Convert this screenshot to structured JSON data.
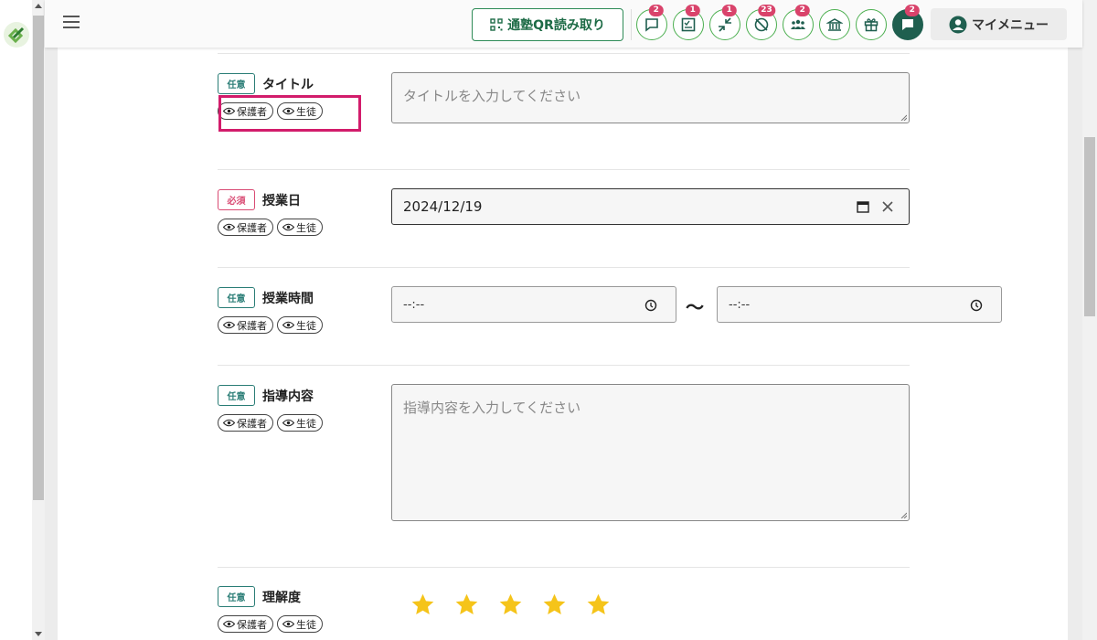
{
  "header": {
    "qr_button_label": "通塾QR読み取り",
    "icons": [
      {
        "name": "message-icon",
        "badge": "2"
      },
      {
        "name": "checklist-icon",
        "badge": "1"
      },
      {
        "name": "transfer-icon",
        "badge": "1"
      },
      {
        "name": "no-entry-icon",
        "badge": "23"
      },
      {
        "name": "group-icon",
        "badge": "2"
      },
      {
        "name": "school-icon",
        "badge": ""
      },
      {
        "name": "gift-icon",
        "badge": ""
      },
      {
        "name": "chat-icon",
        "badge": "2"
      }
    ],
    "my_menu_label": "マイメニュー"
  },
  "visibility_labels": {
    "guardian": "保護者",
    "student": "生徒"
  },
  "fields": {
    "title": {
      "badge": "任意",
      "label": "タイトル",
      "placeholder": "タイトルを入力してください"
    },
    "lesson_date": {
      "badge": "必須",
      "label": "授業日",
      "value": "2024/12/19"
    },
    "lesson_time": {
      "badge": "任意",
      "label": "授業時間",
      "start": "--:--",
      "separator": "〜",
      "end": "--:--"
    },
    "guidance": {
      "badge": "任意",
      "label": "指導内容",
      "placeholder": "指導内容を入力してください"
    },
    "understanding": {
      "badge": "任意",
      "label": "理解度",
      "stars": 5
    }
  },
  "colors": {
    "accent": "#1f5f4f",
    "required": "#d94a73",
    "optional": "#2a7d76",
    "highlight": "#d21c6b",
    "star": "#f5c41a"
  }
}
